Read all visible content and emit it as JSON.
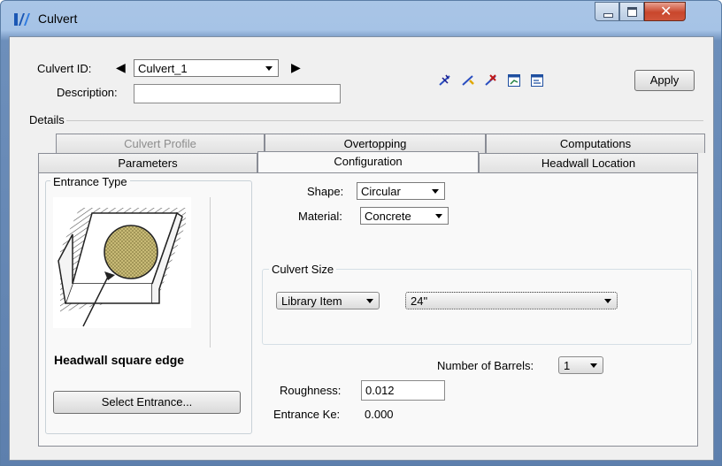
{
  "window": {
    "title": "Culvert"
  },
  "header": {
    "culvert_id_label": "Culvert ID:",
    "culvert_id_value": "Culvert_1",
    "description_label": "Description:",
    "description_value": "",
    "apply_label": "Apply"
  },
  "toolbar": {
    "icons": [
      "locate-icon",
      "select-icon",
      "delete-icon",
      "profile-view-icon",
      "report-icon"
    ]
  },
  "details": {
    "label": "Details",
    "tabs_row1": [
      "Culvert Profile",
      "Overtopping",
      "Computations"
    ],
    "tabs_row2": [
      "Parameters",
      "Configuration",
      "Headwall Location"
    ],
    "active_tab": "Configuration"
  },
  "entrance": {
    "group_label": "Entrance Type",
    "name": "Headwall square edge",
    "select_button": "Select Entrance..."
  },
  "config": {
    "shape_label": "Shape:",
    "shape_value": "Circular",
    "material_label": "Material:",
    "material_value": "Concrete",
    "culvert_size_label": "Culvert Size",
    "size_source_value": "Library Item",
    "size_value": "24\"",
    "barrels_label": "Number of Barrels:",
    "barrels_value": "1",
    "roughness_label": "Roughness:",
    "roughness_value": "0.012",
    "entrance_ke_label": "Entrance Ke:",
    "entrance_ke_value": "0.000"
  }
}
